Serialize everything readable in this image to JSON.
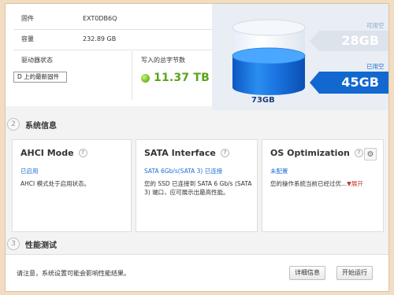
{
  "info": {
    "firmware_label": "固件",
    "firmware_value": "EXT0DB6Q",
    "capacity_label": "容量",
    "capacity_value": "232.89 GB",
    "drive_status_label": "驱动器状态",
    "firmware_button": "D 上的最新固件",
    "tbw_label": "写入的总字节数",
    "tbw_value": "11.37 TB"
  },
  "capacity": {
    "total": "73GB",
    "free_label": "可用空间",
    "free_value": "28GB",
    "used_label": "已用空间",
    "used_value": "45GB"
  },
  "sections": {
    "system_info": {
      "number": "2",
      "title": "系统信息"
    },
    "performance": {
      "number": "3",
      "title": "性能测试"
    }
  },
  "cards": {
    "ahci": {
      "title": "AHCI Mode",
      "help": "?",
      "status": "已启用",
      "desc": "AHCI 模式处于启用状态。"
    },
    "sata": {
      "title": "SATA Interface",
      "help": "?",
      "status": "SATA 6Gb/s(SATA 3) 已连接",
      "desc": "您的 SSD 已连接到 SATA 6 Gb/s (SATA 3) 端口，应可展示出最高性能。"
    },
    "os": {
      "title": "OS Optimization",
      "help": "?",
      "status": "未配置",
      "desc": "您的操作系统当前已经过优...",
      "expand": "▼展开"
    }
  },
  "performance": {
    "note": "请注意，系统设置可能会影响性能结果。",
    "btn1": "详细信息",
    "btn2": "开始运行"
  },
  "colors": {
    "accent_blue": "#1268cf",
    "green": "#5aa51c",
    "status_blue": "#1e6ed6"
  }
}
